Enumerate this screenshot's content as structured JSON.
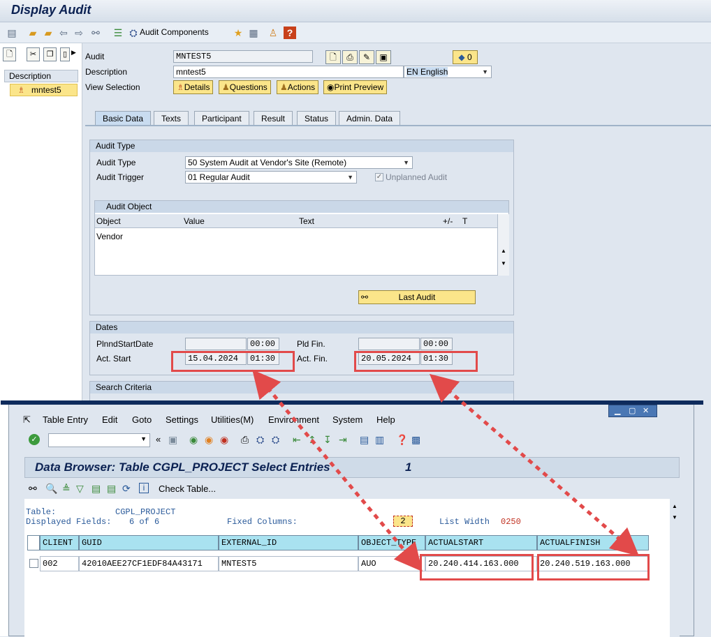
{
  "window_title": "Display Audit",
  "toolbar": {
    "audit_components": "Audit Components"
  },
  "nav": {
    "description_header": "Description",
    "tree_item": "mntest5"
  },
  "header": {
    "audit_label": "Audit",
    "audit_value": "MNTEST5",
    "description_label": "Description",
    "description_value": "mntest5",
    "language_value": "EN English",
    "view_selection_label": "View Selection",
    "count_badge": "0",
    "view_buttons": [
      "Details",
      "Questions",
      "Actions",
      "Print Preview"
    ]
  },
  "tabs": [
    "Basic Data",
    "Texts",
    "Participant",
    "Result",
    "Status",
    "Admin. Data"
  ],
  "audit_type_group": {
    "title": "Audit Type",
    "type_label": "Audit Type",
    "type_value": "50 System Audit at Vendor's Site (Remote)",
    "trigger_label": "Audit Trigger",
    "trigger_value": "01 Regular Audit",
    "unplanned_label": "Unplanned Audit"
  },
  "audit_object": {
    "title": "Audit Object",
    "columns": [
      "Object",
      "Value",
      "Text",
      "+/-",
      "T"
    ],
    "rows": [
      [
        "Vendor",
        "",
        ""
      ]
    ],
    "last_audit_label": "Last Audit"
  },
  "dates": {
    "title": "Dates",
    "plnd_start_label": "PlnndStartDate",
    "plnd_start_date": "",
    "plnd_start_time": "00:00",
    "pld_fin_label": "Pld Fin.",
    "pld_fin_date": "",
    "pld_fin_time": "00:00",
    "act_start_label": "Act. Start",
    "act_start_date": "15.04.2024",
    "act_start_time": "01:30",
    "act_fin_label": "Act. Fin.",
    "act_fin_date": "20.05.2024",
    "act_fin_time": "01:30"
  },
  "search_criteria": {
    "title": "Search Criteria"
  },
  "popup": {
    "menu": [
      "Table Entry",
      "Edit",
      "Goto",
      "Settings",
      "Utilities(M)",
      "Environment",
      "System",
      "Help"
    ],
    "title": "Data Browser: Table CGPL_PROJECT Select Entries",
    "entries_count": "1",
    "check_table_label": "Check Table...",
    "table_label": "Table:",
    "table_value": "CGPL_PROJECT",
    "displayed_fields_label": "Displayed Fields:",
    "displayed_fields_value": "6 of  6",
    "fixed_columns_label": "Fixed Columns:",
    "fixed_columns_value": "2",
    "list_width_label": "List Width",
    "list_width_value": "0250",
    "columns": [
      "CLIENT",
      "GUID",
      "EXTERNAL_ID",
      "OBJECT_TYPE",
      "ACTUALSTART",
      "ACTUALFINISH"
    ],
    "row": [
      "002",
      "42010AEE27CF1EDF84A43171",
      "MNTEST5",
      "AUO",
      "20.240.414.163.000",
      "20.240.519.163.000"
    ]
  },
  "colors": {
    "highlight": "#e24a4a",
    "header_cell": "#a9e2f0",
    "button": "#fbe58a"
  }
}
